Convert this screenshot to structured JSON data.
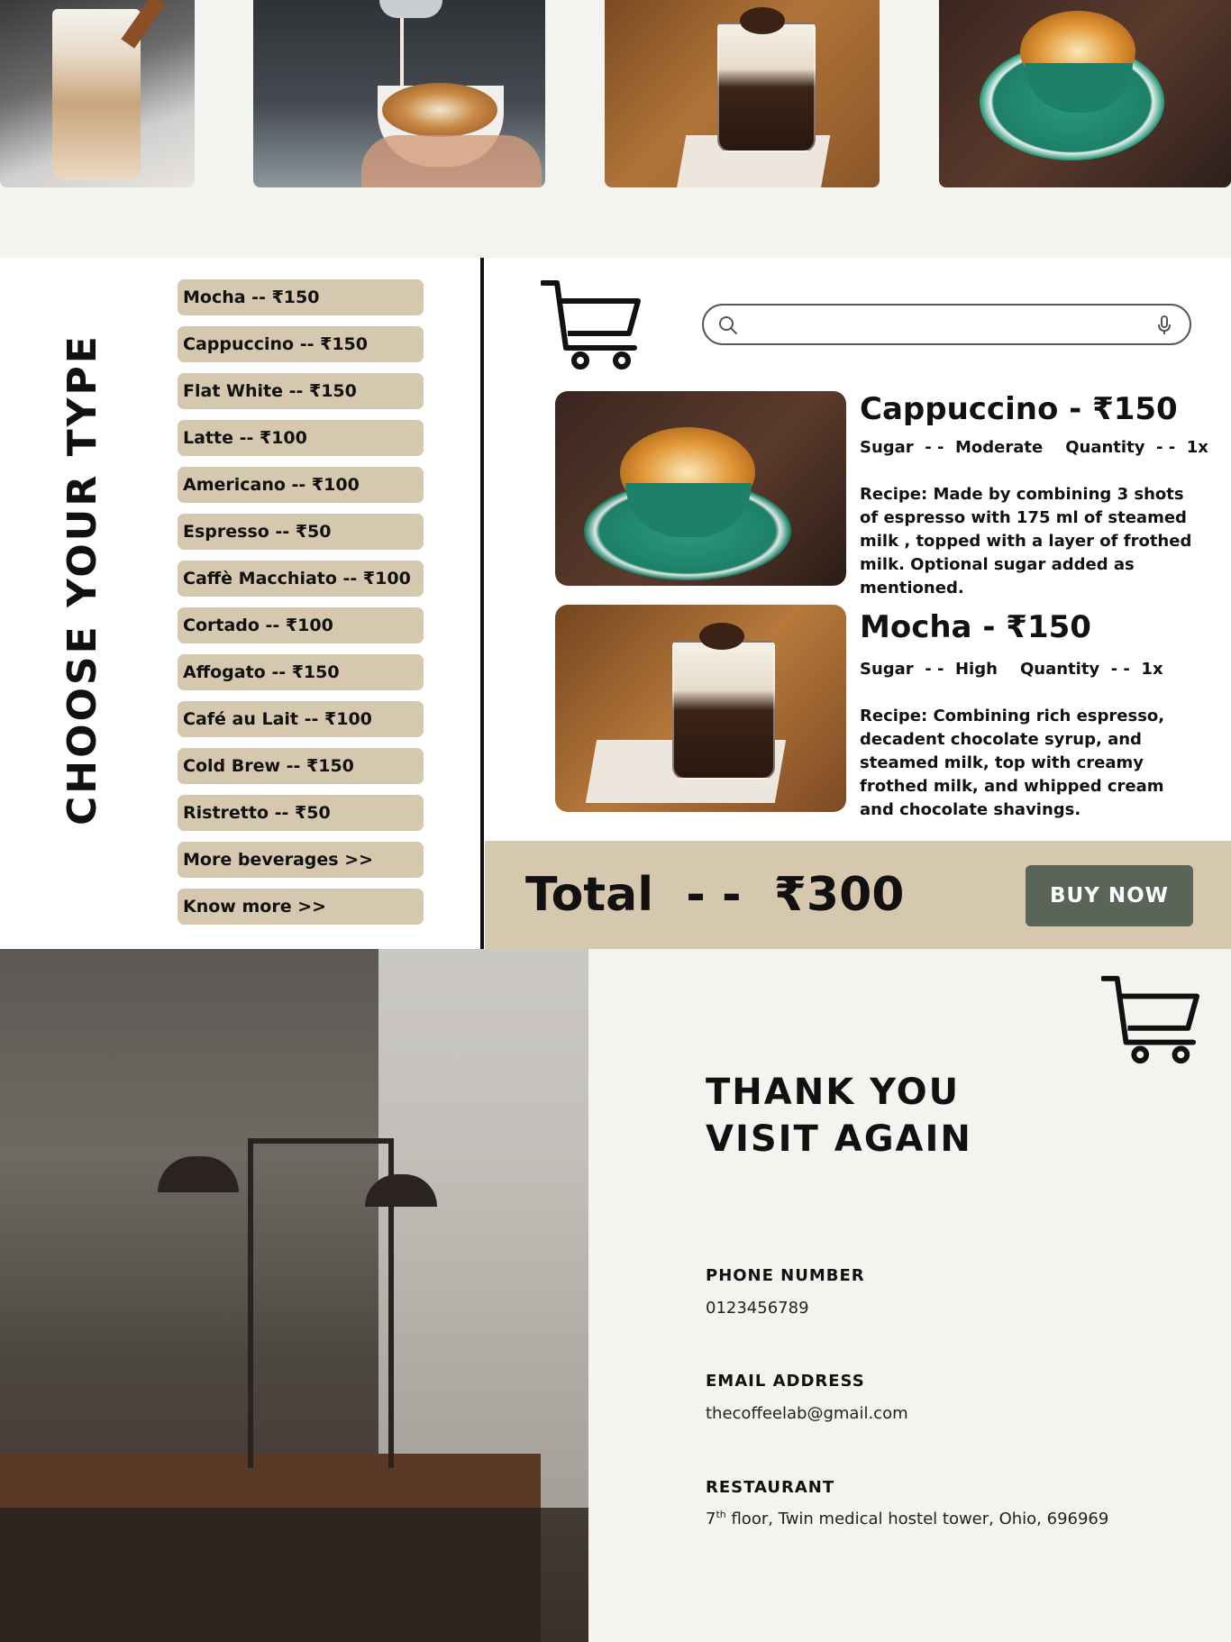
{
  "gallery": {
    "images": [
      "latte-photo",
      "latte-art-pour-photo",
      "mocha-photo",
      "cappuccino-photo"
    ]
  },
  "menu": {
    "title": "CHOOSE YOUR TYPE",
    "items": [
      "Mocha -- ₹150",
      "Cappuccino -- ₹150",
      "Flat White -- ₹150",
      "Latte -- ₹100",
      "Americano -- ₹100",
      "Espresso -- ₹50",
      "Caffè Macchiato -- ₹100",
      "Cortado -- ₹100",
      "Affogato -- ₹150",
      "Café au Lait -- ₹100",
      "Cold Brew -- ₹150",
      "Ristretto -- ₹50",
      "More beverages >>",
      "Know more >>"
    ]
  },
  "search": {
    "placeholder": "",
    "icons": [
      "search-icon",
      "microphone-icon"
    ]
  },
  "cart": {
    "orders": [
      {
        "title": "Cappuccino - ₹150",
        "meta": "Sugar  - -  Moderate    Quantity  - -  1x",
        "recipe": "Recipe: Made by combining 3 shots of espresso with 175 ml of steamed milk , topped with a layer of frothed milk. Optional sugar added as mentioned."
      },
      {
        "title": "Mocha - ₹150",
        "meta": "Sugar  - -  High    Quantity  - -  1x",
        "recipe": "Recipe: Combining rich espresso, decadent chocolate syrup, and steamed milk, top with creamy frothed milk, and whipped cream and chocolate shavings."
      }
    ],
    "total": "Total  - -  ₹300",
    "buy_label": "BUY NOW"
  },
  "contact": {
    "thanks_line1": "THANK YOU",
    "thanks_line2": "VISIT AGAIN",
    "phone_label": "PHONE NUMBER",
    "phone": "0123456789",
    "email_label": "EMAIL ADDRESS",
    "email": "thecoffeelab@gmail.com",
    "restaurant_label": "RESTAURANT",
    "floor_num": "7",
    "floor_sup": "th",
    "address": " floor, Twin medical hostel tower, Ohio, 696969"
  },
  "colors": {
    "beige": "#d6c8ae",
    "button": "#5a6457",
    "background": "#f3f3ef"
  }
}
